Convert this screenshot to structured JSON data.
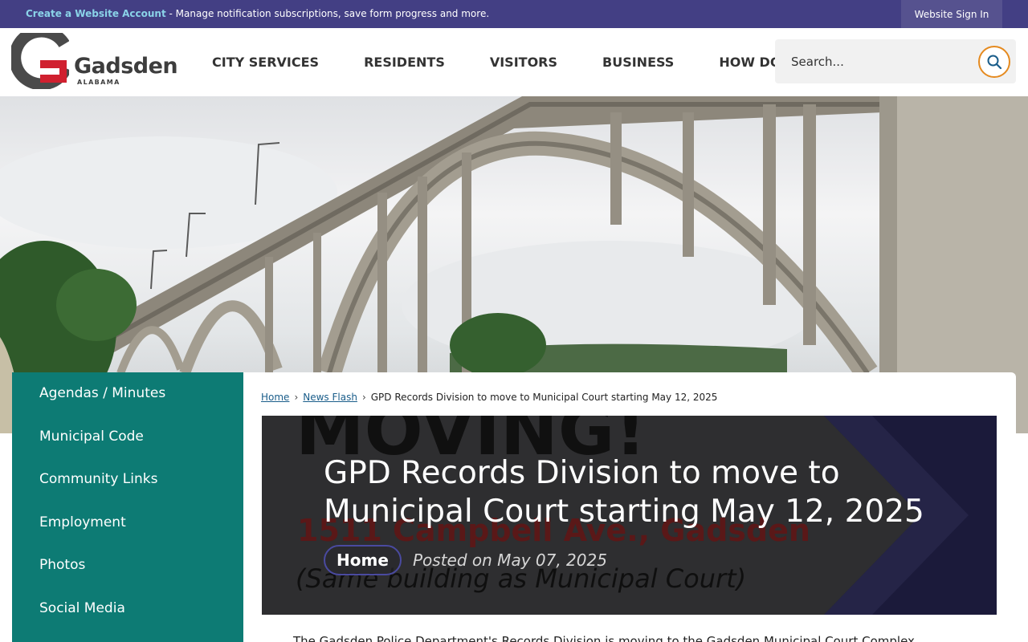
{
  "topbar": {
    "create_link": "Create a Website Account",
    "message": " - Manage notification subscriptions, save form progress and more.",
    "signin": "Website Sign In"
  },
  "logo": {
    "name": "Gadsden",
    "state": "ALABAMA"
  },
  "nav": {
    "items": [
      "CITY SERVICES",
      "RESIDENTS",
      "VISITORS",
      "BUSINESS",
      "HOW DO I?"
    ]
  },
  "search": {
    "placeholder": "Search..."
  },
  "sidebar": {
    "items": [
      "Agendas / Minutes",
      "Municipal Code",
      "Community Links",
      "Employment",
      "Photos",
      "Social Media"
    ]
  },
  "breadcrumb": {
    "home": "Home",
    "news": "News Flash",
    "current": "GPD Records Division to move to Municipal Court starting May 12, 2025",
    "separator": "›"
  },
  "article": {
    "title": "GPD Records Division to move to Municipal Court starting May 12, 2025",
    "category": "Home",
    "posted": "Posted on May 07, 2025",
    "banner_text_1": "MOVING!",
    "banner_text_2": "1511 Campbell Ave., Gadsden",
    "banner_text_3": "(Same building as Municipal Court)",
    "body_start": "The Gadsden Police Department's Records Division is moving to the Gadsden Municipal Court Complex"
  },
  "colors": {
    "topbar": "#433f84",
    "sidebar": "#0d7b74",
    "accent_orange": "#e58a1f",
    "logo_red": "#d0202f"
  }
}
